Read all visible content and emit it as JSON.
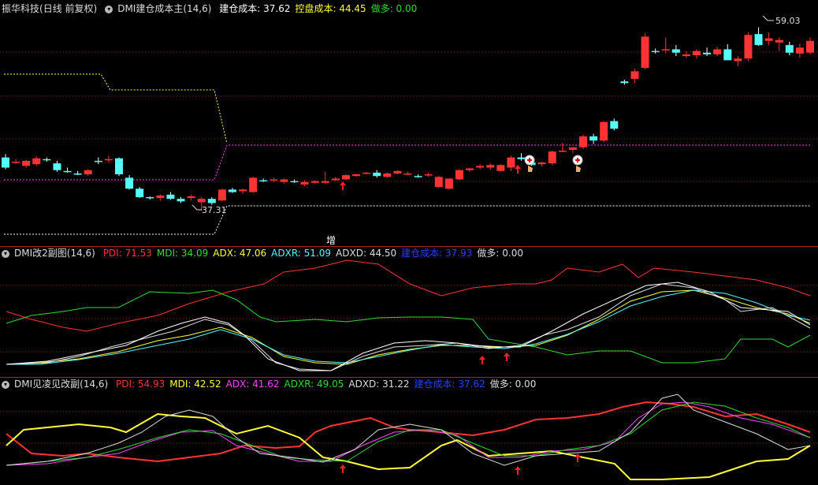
{
  "colors": {
    "up": "#ff3333",
    "down": "#54fcfc",
    "pdi": "#ff3333",
    "mdi": "#2ddc2d",
    "adx": "#ffff33",
    "adxr": "#54fcfc",
    "adxd": "#dddddd",
    "cost": "#1f3fff",
    "grid": "#8a1a1a"
  },
  "panel1": {
    "stock_name": "振华科技",
    "period": "(日线 前复权)",
    "indicator": "DMI建仓成本主(14,6)",
    "items": [
      {
        "label": "建仓成本:",
        "value": "37.62",
        "color": "#ffffff"
      },
      {
        "label": "控盘成本:",
        "value": "44.45",
        "color": "#ffff33"
      },
      {
        "label": "做多:",
        "value": "0.00",
        "color": "#2ddc2d"
      }
    ],
    "high_label": "59.03",
    "low_label": "37.31",
    "zeng_label": "增",
    "icon": "chevron-down-icon"
  },
  "panel2": {
    "indicator": "DMI改2副图(14,6)",
    "items": [
      {
        "label": "PDI:",
        "value": "71.53",
        "color": "#ff3333"
      },
      {
        "label": "MDI:",
        "value": "34.09",
        "color": "#2ddc2d"
      },
      {
        "label": "ADX:",
        "value": "47.06",
        "color": "#ffff33"
      },
      {
        "label": "ADXR:",
        "value": "51.09",
        "color": "#54fcfc"
      },
      {
        "label": "ADXD:",
        "value": "44.50",
        "color": "#dddddd"
      },
      {
        "label": "建仓成本:",
        "value": "37.93",
        "color": "#1f3fff"
      },
      {
        "label": "做多:",
        "value": "0.00",
        "color": "#dddddd"
      }
    ]
  },
  "panel3": {
    "indicator": "DMI见凌见改副(14,6)",
    "items": [
      {
        "label": "PDI:",
        "value": "54.93",
        "color": "#ff3333"
      },
      {
        "label": "MDI:",
        "value": "42.52",
        "color": "#ffff33"
      },
      {
        "label": "ADX:",
        "value": "41.62",
        "color": "#ff44ff"
      },
      {
        "label": "ADXR:",
        "value": "49.05",
        "color": "#2ddc2d"
      },
      {
        "label": "ADXD:",
        "value": "31.22",
        "color": "#dddddd"
      },
      {
        "label": "建仓成本:",
        "value": "37.62",
        "color": "#1f3fff"
      },
      {
        "label": "做多:",
        "value": "0.00",
        "color": "#dddddd"
      }
    ]
  },
  "chart_data": {
    "type": "candlestick",
    "candles": [
      [
        43.6,
        44.0,
        42.2,
        42.4
      ],
      [
        43.0,
        43.4,
        42.8,
        43.1
      ],
      [
        42.6,
        43.3,
        42.4,
        43.2
      ],
      [
        42.8,
        43.7,
        42.6,
        43.5
      ],
      [
        43.4,
        43.6,
        43.1,
        43.3
      ],
      [
        42.9,
        43.2,
        41.9,
        42.1
      ],
      [
        42.0,
        42.4,
        41.8,
        41.9
      ],
      [
        41.7,
        42.0,
        41.5,
        41.6
      ],
      [
        41.6,
        42.2,
        41.4,
        42.1
      ],
      [
        43.2,
        43.6,
        42.8,
        43.1
      ],
      [
        43.3,
        43.8,
        43.0,
        43.4
      ],
      [
        43.5,
        43.6,
        41.4,
        41.6
      ],
      [
        41.2,
        41.5,
        39.8,
        39.9
      ],
      [
        39.9,
        40.1,
        38.8,
        38.9
      ],
      [
        38.9,
        39.0,
        38.6,
        38.8
      ],
      [
        38.8,
        39.2,
        38.5,
        39.1
      ],
      [
        39.2,
        39.5,
        38.6,
        38.7
      ],
      [
        38.7,
        38.9,
        38.2,
        38.4
      ],
      [
        38.8,
        39.2,
        38.5,
        39.0
      ],
      [
        38.3,
        38.9,
        37.3,
        38.7
      ],
      [
        38.7,
        38.9,
        38.0,
        38.2
      ],
      [
        38.5,
        39.9,
        38.4,
        39.8
      ],
      [
        39.8,
        40.0,
        39.4,
        39.5
      ],
      [
        39.6,
        39.9,
        39.3,
        39.8
      ],
      [
        39.5,
        41.3,
        39.4,
        41.2
      ],
      [
        40.9,
        41.1,
        40.7,
        40.8
      ],
      [
        40.9,
        41.2,
        40.7,
        41.0
      ],
      [
        40.7,
        41.1,
        40.5,
        41.0
      ],
      [
        40.8,
        41.0,
        40.6,
        40.7
      ],
      [
        40.4,
        40.9,
        40.2,
        40.7
      ],
      [
        40.6,
        40.9,
        40.5,
        40.8
      ],
      [
        40.6,
        41.9,
        40.5,
        40.8
      ],
      [
        40.9,
        41.3,
        40.8,
        41.1
      ],
      [
        41.0,
        41.6,
        40.9,
        41.5
      ],
      [
        41.4,
        41.7,
        41.3,
        41.6
      ],
      [
        41.7,
        41.9,
        41.6,
        41.8
      ],
      [
        41.8,
        42.1,
        41.2,
        41.4
      ],
      [
        41.3,
        41.8,
        41.2,
        41.7
      ],
      [
        41.7,
        42.1,
        41.6,
        42.0
      ],
      [
        41.6,
        41.9,
        41.5,
        41.7
      ],
      [
        41.4,
        41.6,
        41.2,
        41.3
      ],
      [
        41.5,
        41.8,
        41.3,
        41.6
      ],
      [
        40.1,
        41.4,
        40.0,
        41.3
      ],
      [
        39.9,
        41.1,
        39.8,
        41.1
      ],
      [
        41.0,
        42.2,
        40.9,
        42.1
      ],
      [
        42.1,
        42.4,
        41.9,
        42.3
      ],
      [
        42.4,
        42.8,
        42.2,
        42.6
      ],
      [
        42.4,
        42.9,
        42.1,
        42.7
      ],
      [
        42.0,
        42.8,
        41.9,
        42.7
      ],
      [
        42.4,
        43.8,
        42.0,
        43.6
      ],
      [
        43.6,
        44.1,
        43.2,
        43.4
      ],
      [
        43.0,
        43.8,
        42.6,
        42.7
      ],
      [
        42.8,
        43.1,
        42.5,
        43.0
      ],
      [
        42.9,
        44.4,
        42.7,
        44.3
      ],
      [
        44.3,
        45.3,
        44.2,
        44.4
      ],
      [
        44.5,
        44.8,
        44.1,
        44.8
      ],
      [
        44.8,
        46.3,
        44.6,
        46.1
      ],
      [
        46.1,
        46.4,
        45.2,
        45.6
      ],
      [
        45.6,
        47.9,
        45.4,
        47.8
      ],
      [
        47.9,
        48.2,
        46.8,
        47.0
      ],
      [
        52.6,
        52.8,
        52.2,
        52.4
      ],
      [
        52.9,
        54.1,
        52.4,
        53.8
      ],
      [
        54.2,
        58.3,
        54.0,
        57.9
      ],
      [
        56.2,
        56.5,
        55.9,
        56.1
      ],
      [
        56.3,
        57.8,
        55.9,
        56.4
      ],
      [
        56.4,
        56.9,
        55.6,
        56.0
      ],
      [
        55.6,
        56.2,
        55.4,
        55.8
      ],
      [
        55.7,
        56.4,
        55.3,
        56.2
      ],
      [
        56.0,
        56.6,
        55.6,
        55.8
      ],
      [
        55.8,
        56.7,
        55.6,
        56.4
      ],
      [
        56.4,
        57.0,
        55.2,
        55.1
      ],
      [
        55.0,
        55.6,
        54.4,
        55.3
      ],
      [
        55.3,
        58.4,
        55.0,
        58.1
      ],
      [
        58.2,
        59.0,
        56.8,
        56.9
      ],
      [
        57.4,
        58.4,
        56.9,
        57.7
      ],
      [
        57.2,
        57.8,
        56.2,
        57.5
      ],
      [
        56.9,
        57.3,
        55.7,
        56.0
      ],
      [
        55.9,
        57.1,
        55.4,
        56.6
      ],
      [
        56.0,
        57.8,
        55.8,
        57.4
      ]
    ],
    "lines": {
      "build_cost": "37.62",
      "control_cost": "44.45"
    },
    "high": 59.03,
    "low": 37.31
  }
}
